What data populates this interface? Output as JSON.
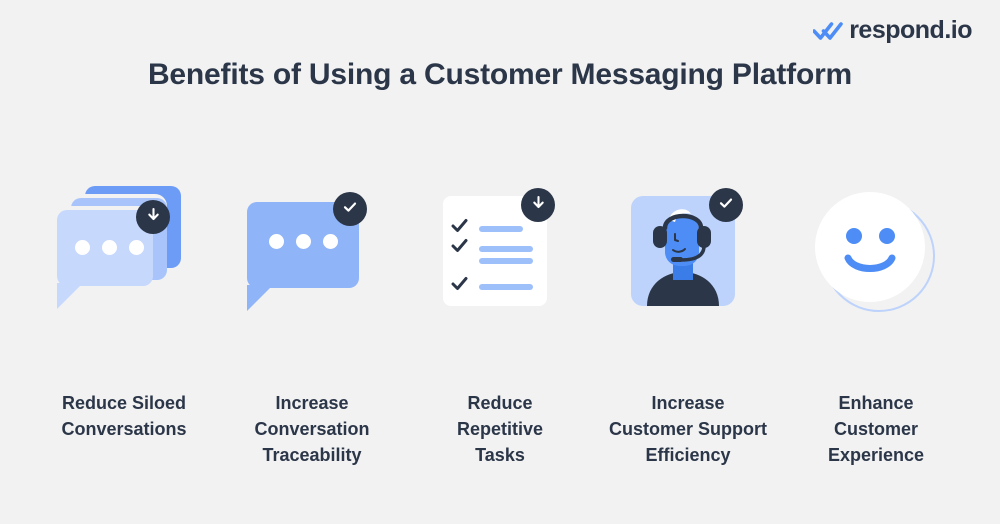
{
  "background_color": "#f2f2f2",
  "brand": {
    "name": "respond.io",
    "logo_icon": "double-check-icon",
    "logo_color": "#4d8df5",
    "text_color": "#2b3648"
  },
  "header": {
    "title": "Benefits of Using a Customer Messaging Platform",
    "title_color": "#2b3648"
  },
  "palette": {
    "blue_primary": "#4d8df5",
    "blue_mid": "#7ea9f7",
    "blue_light": "#a8c4fa",
    "blue_lighter": "#c7d8fd",
    "navy_dark": "#2b3648",
    "white": "#ffffff"
  },
  "benefits": [
    {
      "id": "reduce-siloed-conversations",
      "label": "Reduce Siloed\nConversations",
      "label_line1": "Reduce Siloed",
      "label_line2": "Conversations",
      "icon": "stacked-chat-bubbles-icon",
      "badge": "download-arrow-badge",
      "badge_icon": "arrow-down-icon"
    },
    {
      "id": "increase-conversation-traceability",
      "label": "Increase\nConversation\nTraceability",
      "label_line1": "Increase",
      "label_line2": "Conversation",
      "label_line3": "Traceability",
      "icon": "chat-bubble-icon",
      "badge": "check-badge",
      "badge_icon": "check-icon"
    },
    {
      "id": "reduce-repetitive-tasks",
      "label": "Reduce\nRepetitive\nTasks",
      "label_line1": "Reduce",
      "label_line2": "Repetitive",
      "label_line3": "Tasks",
      "icon": "checklist-icon",
      "badge": "download-arrow-badge",
      "badge_icon": "arrow-down-icon"
    },
    {
      "id": "increase-customer-support-efficiency",
      "label": "Increase\nCustomer Support\nEfficiency",
      "label_line1": "Increase",
      "label_line2": "Customer Support",
      "label_line3": "Efficiency",
      "icon": "support-agent-headset-icon",
      "badge": "check-badge",
      "badge_icon": "check-icon"
    },
    {
      "id": "enhance-customer-experience",
      "label": "Enhance\nCustomer\nExperience",
      "label_line1": "Enhance",
      "label_line2": "Customer",
      "label_line3": "Experience",
      "icon": "smiley-face-icon",
      "badge": "none",
      "badge_icon": ""
    }
  ]
}
